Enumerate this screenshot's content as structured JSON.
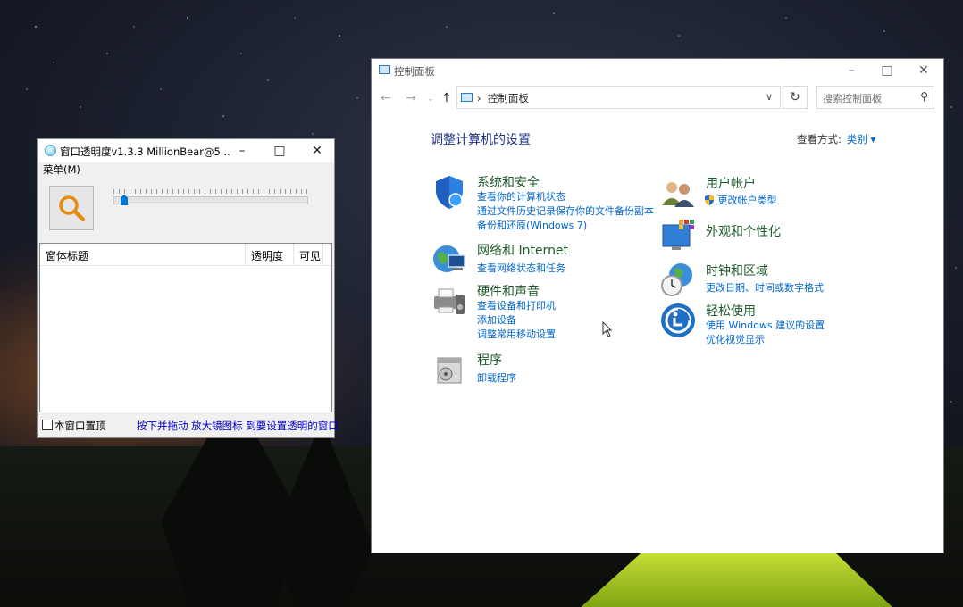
{
  "transparency_tool": {
    "title": "窗口透明度v1.3.3    MillionBear@5...",
    "menu": "菜单(M)",
    "columns": [
      "窗体标题",
      "透明度",
      "可见"
    ],
    "topmost_checkbox": "本窗口置顶",
    "hint": "按下并拖动 放大镜图标 到要设置透明的窗口",
    "slider_level": 0.04
  },
  "control_panel": {
    "title": "控制面板",
    "breadcrumb": "控制面板",
    "search_placeholder": "搜索控制面板",
    "heading": "调整计算机的设置",
    "view_by_label": "查看方式:",
    "view_by_value": "类别",
    "left_categories": [
      {
        "title": "系统和安全",
        "links": [
          "查看你的计算机状态",
          "通过文件历史记录保存你的文件备份副本",
          "备份和还原(Windows 7)"
        ]
      },
      {
        "title": "网络和 Internet",
        "links": [
          "查看网络状态和任务"
        ]
      },
      {
        "title": "硬件和声音",
        "links": [
          "查看设备和打印机",
          "添加设备",
          "调整常用移动设置"
        ]
      },
      {
        "title": "程序",
        "links": [
          "卸载程序"
        ]
      }
    ],
    "right_categories": [
      {
        "title": "用户帐户",
        "links": [
          "更改帐户类型"
        ]
      },
      {
        "title": "外观和个性化",
        "links": []
      },
      {
        "title": "时钟和区域",
        "links": [
          "更改日期、时间或数字格式"
        ]
      },
      {
        "title": "轻松使用",
        "links": [
          "使用 Windows 建议的设置",
          "优化视觉显示"
        ]
      }
    ]
  },
  "colors": {
    "link": "#0066cc",
    "category_title": "#1e5a2a",
    "heading": "#1e3287",
    "accent": "#0078d7"
  }
}
